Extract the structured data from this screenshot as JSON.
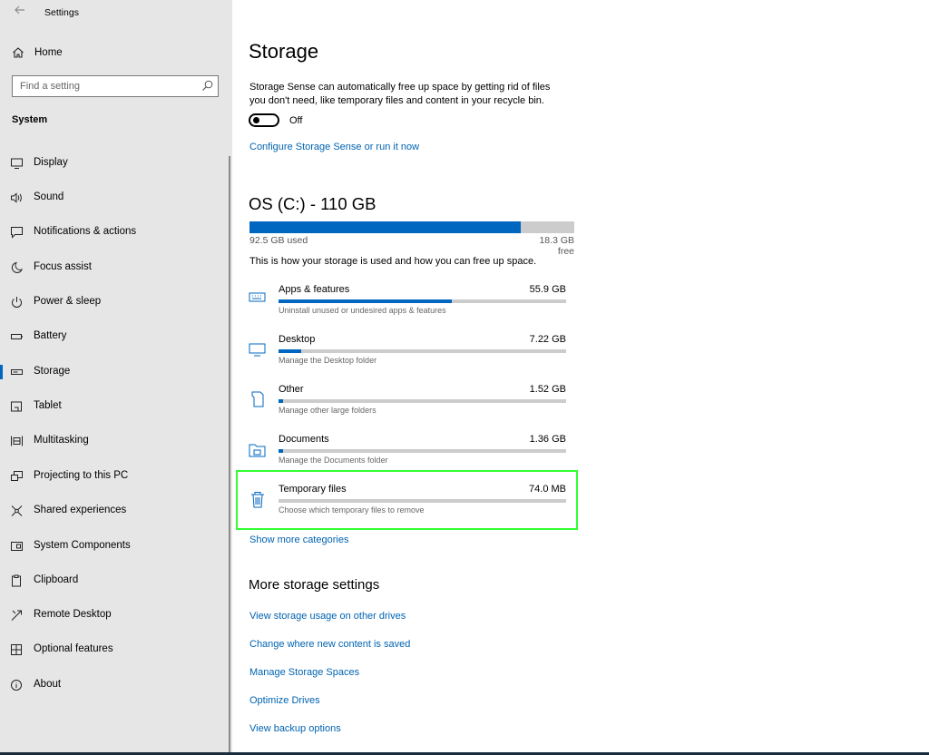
{
  "window": {
    "title": "Settings"
  },
  "sidebar": {
    "home_label": "Home",
    "search_placeholder": "Find a setting",
    "section": "System",
    "items": [
      {
        "label": "Display",
        "icon": "monitor-icon"
      },
      {
        "label": "Sound",
        "icon": "speaker-icon"
      },
      {
        "label": "Notifications & actions",
        "icon": "notification-icon"
      },
      {
        "label": "Focus assist",
        "icon": "moon-icon"
      },
      {
        "label": "Power & sleep",
        "icon": "power-icon"
      },
      {
        "label": "Battery",
        "icon": "battery-icon"
      },
      {
        "label": "Storage",
        "icon": "storage-icon",
        "active": true
      },
      {
        "label": "Tablet",
        "icon": "tablet-icon"
      },
      {
        "label": "Multitasking",
        "icon": "multitasking-icon"
      },
      {
        "label": "Projecting to this PC",
        "icon": "projector-icon"
      },
      {
        "label": "Shared experiences",
        "icon": "share-icon"
      },
      {
        "label": "System Components",
        "icon": "components-icon"
      },
      {
        "label": "Clipboard",
        "icon": "clipboard-icon"
      },
      {
        "label": "Remote Desktop",
        "icon": "remote-icon"
      },
      {
        "label": "Optional features",
        "icon": "features-icon"
      },
      {
        "label": "About",
        "icon": "info-icon"
      }
    ]
  },
  "main": {
    "title": "Storage",
    "sense_desc": "Storage Sense can automatically free up space by getting rid of files you don't need, like temporary files and content in your recycle bin.",
    "toggle_state": "Off",
    "configure_link": "Configure Storage Sense or run it now",
    "drive": {
      "title": "OS (C:) - 110 GB",
      "used_label": "92.5 GB used",
      "free_label": "18.3 GB free",
      "used_fraction": 0.835
    },
    "usage_desc": "This is how your storage is used and how you can free up space.",
    "categories": [
      {
        "name": "Apps & features",
        "size": "55.9 GB",
        "desc": "Uninstall unused or undesired apps & features",
        "fraction": 0.604,
        "icon": "apps-icon"
      },
      {
        "name": "Desktop",
        "size": "7.22 GB",
        "desc": "Manage the Desktop folder",
        "fraction": 0.078,
        "icon": "desktop-icon"
      },
      {
        "name": "Other",
        "size": "1.52 GB",
        "desc": "Manage other large folders",
        "fraction": 0.016,
        "icon": "other-icon"
      },
      {
        "name": "Documents",
        "size": "1.36 GB",
        "desc": "Manage the Documents folder",
        "fraction": 0.015,
        "icon": "documents-icon"
      },
      {
        "name": "Temporary files",
        "size": "74.0 MB",
        "desc": "Choose which temporary files to remove",
        "fraction": 0.0,
        "icon": "trash-icon"
      }
    ],
    "show_more": "Show more categories",
    "more_title": "More storage settings",
    "more_links": [
      "View storage usage on other drives",
      "Change where new content is saved",
      "Manage Storage Spaces",
      "Optimize Drives",
      "View backup options"
    ]
  },
  "colors": {
    "accent": "#0067c0",
    "link": "#0063b1",
    "sidebar_bg": "#e6e6e6",
    "highlight": "#33ff33"
  }
}
